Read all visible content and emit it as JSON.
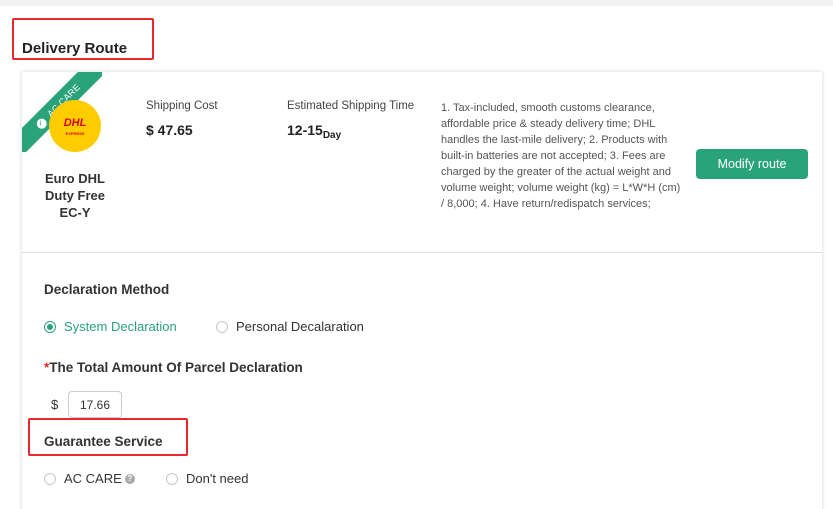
{
  "section_title": "Delivery Route",
  "route": {
    "badge": "AC CARE",
    "logo_text": "DHL",
    "logo_sub": "EXPRESS",
    "name_lines": [
      "Euro DHL",
      "Duty Free",
      "EC-Y"
    ],
    "shipping_cost_label": "Shipping Cost",
    "shipping_cost": "$ 47.65",
    "eta_label": "Estimated Shipping Time",
    "eta_value": "12-15",
    "eta_unit": "Day",
    "description": "1. Tax-included, smooth customs clearance, affordable price & steady delivery time; DHL handles the last-mile delivery; 2. Products with built-in batteries are not accepted; 3. Fees are charged by the greater of the actual weight and volume weight; volume weight (kg) = L*W*H (cm) / 8,000; 4. Have return/redispatch services;",
    "modify_button": "Modify route"
  },
  "declaration": {
    "title": "Declaration Method",
    "options": [
      "System Declaration",
      "Personal Decalaration"
    ],
    "selected": "System Declaration"
  },
  "total": {
    "required_mark": "*",
    "title": "The Total Amount Of Parcel Declaration",
    "currency": "$",
    "amount": "17.66"
  },
  "guarantee": {
    "title": "Guarantee Service",
    "options": [
      "AC CARE",
      "Don't need"
    ],
    "help_icon": "?",
    "selected": ""
  },
  "colors": {
    "accent": "#2aa37b",
    "highlight": "#e8282b",
    "dhl_yellow": "#ffcc00",
    "dhl_red": "#d40511"
  }
}
